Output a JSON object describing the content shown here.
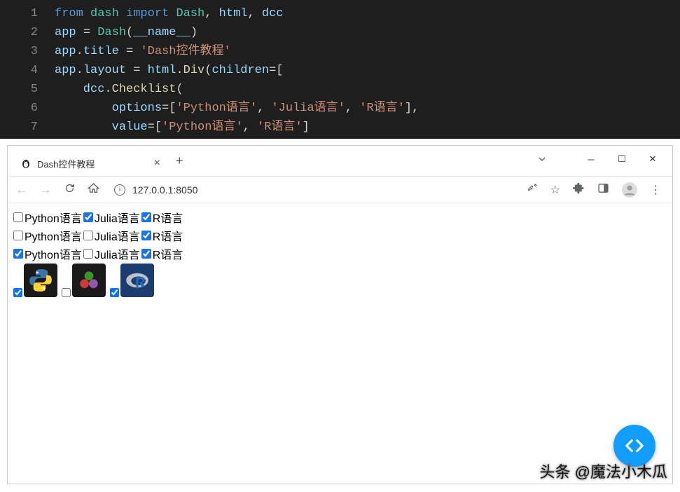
{
  "editor": {
    "line_numbers": [
      "1",
      "2",
      "3",
      "4",
      "5",
      "6",
      "7"
    ],
    "code_lines": [
      [
        {
          "t": "from ",
          "c": "kw"
        },
        {
          "t": "dash ",
          "c": "mod"
        },
        {
          "t": "import ",
          "c": "kw"
        },
        {
          "t": "Dash",
          "c": "mod"
        },
        {
          "t": ", ",
          "c": "punct"
        },
        {
          "t": "html",
          "c": "obj"
        },
        {
          "t": ", ",
          "c": "punct"
        },
        {
          "t": "dcc",
          "c": "obj"
        }
      ],
      [
        {
          "t": "app ",
          "c": "obj"
        },
        {
          "t": "= ",
          "c": "punct"
        },
        {
          "t": "Dash",
          "c": "mod"
        },
        {
          "t": "(",
          "c": "punct"
        },
        {
          "t": "__name__",
          "c": "dunder"
        },
        {
          "t": ")",
          "c": "punct"
        }
      ],
      [
        {
          "t": "app",
          "c": "obj"
        },
        {
          "t": ".",
          "c": "punct"
        },
        {
          "t": "title ",
          "c": "attr"
        },
        {
          "t": "= ",
          "c": "punct"
        },
        {
          "t": "'Dash控件教程'",
          "c": "str"
        }
      ],
      [
        {
          "t": "app",
          "c": "obj"
        },
        {
          "t": ".",
          "c": "punct"
        },
        {
          "t": "layout ",
          "c": "attr"
        },
        {
          "t": "= ",
          "c": "punct"
        },
        {
          "t": "html",
          "c": "obj"
        },
        {
          "t": ".",
          "c": "punct"
        },
        {
          "t": "Div",
          "c": "fn"
        },
        {
          "t": "(",
          "c": "punct"
        },
        {
          "t": "children",
          "c": "attr"
        },
        {
          "t": "=[",
          "c": "punct"
        }
      ],
      [
        {
          "t": "    dcc",
          "c": "obj"
        },
        {
          "t": ".",
          "c": "punct"
        },
        {
          "t": "Checklist",
          "c": "fn"
        },
        {
          "t": "(",
          "c": "punct"
        }
      ],
      [
        {
          "t": "        options",
          "c": "attr"
        },
        {
          "t": "=[",
          "c": "punct"
        },
        {
          "t": "'Python语言'",
          "c": "str"
        },
        {
          "t": ", ",
          "c": "punct"
        },
        {
          "t": "'Julia语言'",
          "c": "str"
        },
        {
          "t": ", ",
          "c": "punct"
        },
        {
          "t": "'R语言'",
          "c": "str"
        },
        {
          "t": "],",
          "c": "punct"
        }
      ],
      [
        {
          "t": "        value",
          "c": "attr"
        },
        {
          "t": "=[",
          "c": "punct"
        },
        {
          "t": "'Python语言'",
          "c": "str"
        },
        {
          "t": ", ",
          "c": "punct"
        },
        {
          "t": "'R语言'",
          "c": "str"
        },
        {
          "t": "]",
          "c": "punct"
        }
      ]
    ]
  },
  "browser": {
    "tab_title": "Dash控件教程",
    "url": "127.0.0.1:8050"
  },
  "page": {
    "checklists": [
      [
        {
          "label": "Python语言",
          "checked": false
        },
        {
          "label": "Julia语言",
          "checked": true
        },
        {
          "label": "R语言",
          "checked": true
        }
      ],
      [
        {
          "label": "Python语言",
          "checked": false
        },
        {
          "label": "Julia语言",
          "checked": false
        },
        {
          "label": "R语言",
          "checked": true
        }
      ],
      [
        {
          "label": "Python语言",
          "checked": true
        },
        {
          "label": "Julia语言",
          "checked": false
        },
        {
          "label": "R语言",
          "checked": true
        }
      ]
    ],
    "logo_checks": [
      {
        "logo": "python",
        "checked": true
      },
      {
        "logo": "julia",
        "checked": false
      },
      {
        "logo": "r",
        "checked": true
      }
    ]
  },
  "watermark": "头条 @魔法小木瓜"
}
